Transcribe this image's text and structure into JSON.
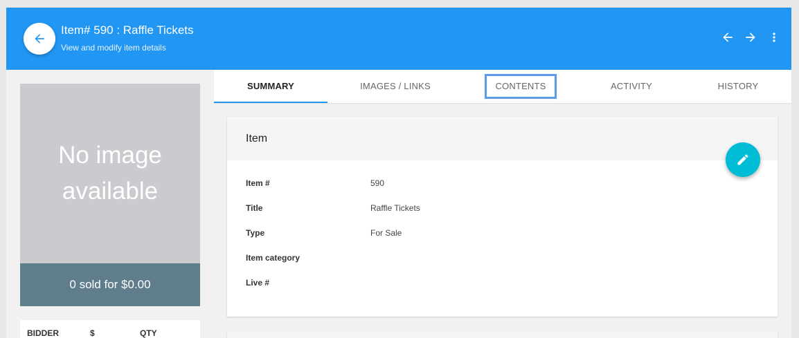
{
  "header": {
    "title": "Item# 590 : Raffle Tickets",
    "subtitle": "View and modify item details",
    "color": "#2196f3"
  },
  "left": {
    "no_image_text_line1": "No image",
    "no_image_text_line2": "available",
    "sold_text": "0 sold for $0.00",
    "bid_columns": [
      "BIDDER",
      "$",
      "QTY"
    ]
  },
  "tabs": [
    {
      "label": "SUMMARY",
      "active": true
    },
    {
      "label": "IMAGES / LINKS",
      "active": false
    },
    {
      "label": "CONTENTS",
      "active": false,
      "highlighted": true
    },
    {
      "label": "ACTIVITY",
      "active": false
    },
    {
      "label": "HISTORY",
      "active": false
    }
  ],
  "card": {
    "title": "Item",
    "fields": [
      {
        "label": "Item #",
        "value": "590"
      },
      {
        "label": "Title",
        "value": "Raffle Tickets"
      },
      {
        "label": "Type",
        "value": "For Sale"
      },
      {
        "label": "Item category",
        "value": ""
      },
      {
        "label": "Live #",
        "value": ""
      }
    ]
  },
  "icons": {
    "back": "arrow-left-icon",
    "prev": "arrow-left-icon",
    "next": "arrow-right-icon",
    "more": "more-vert-icon",
    "edit": "pencil-icon"
  }
}
